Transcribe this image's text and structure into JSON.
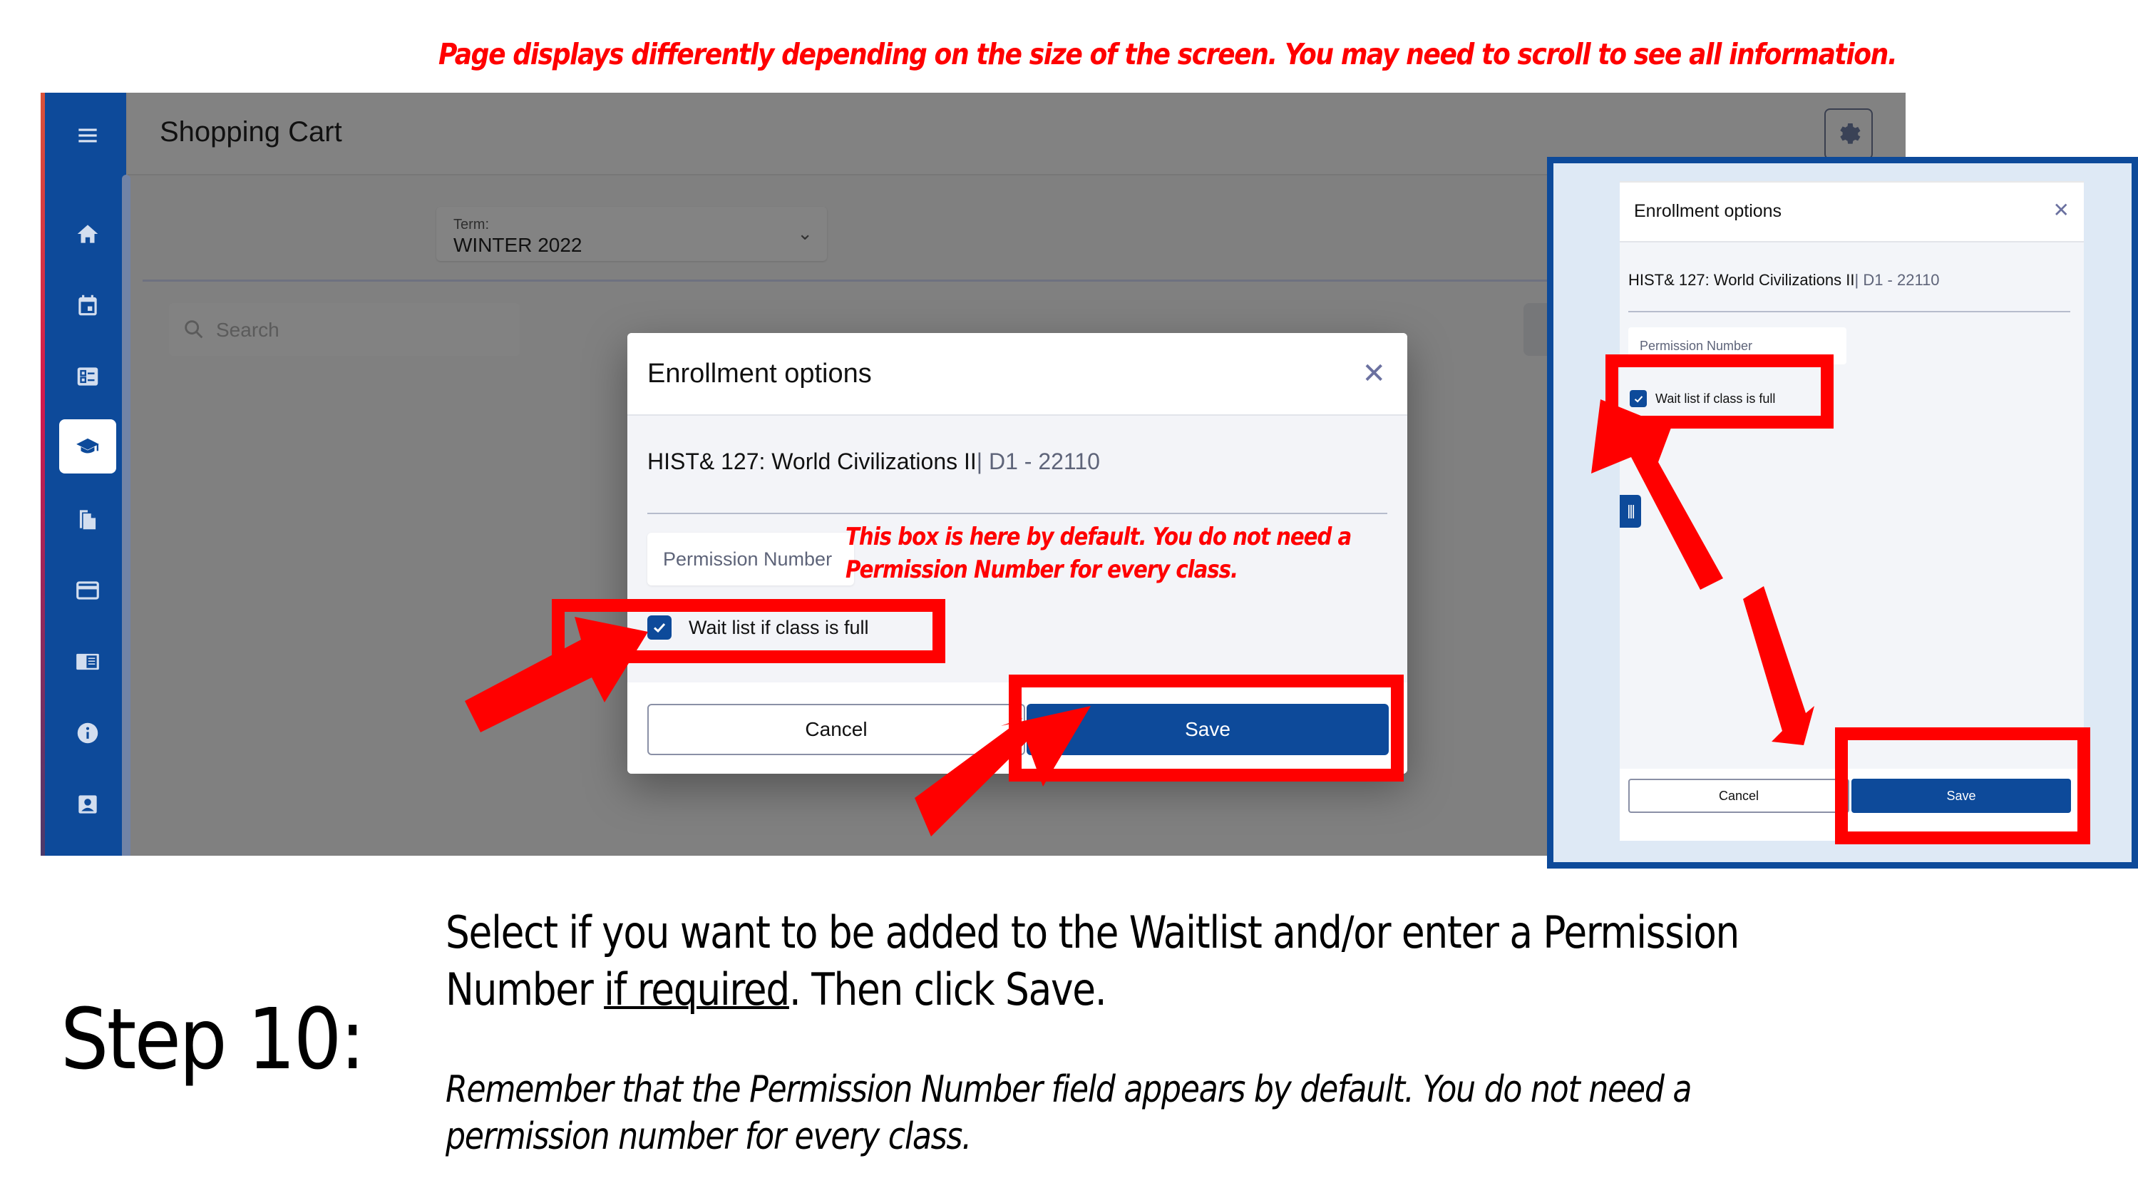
{
  "top_note": "Page displays differently depending on the size of the screen. You may need to scroll to see all information.",
  "app": {
    "header_title": "Shopping Cart",
    "settings_icon": "gear-icon",
    "term": {
      "label": "Term:",
      "value": "WINTER 2022"
    },
    "search": {
      "placeholder": "Search"
    },
    "sidebar": {
      "menu_icon": "hamburger-menu-icon",
      "items": [
        {
          "icon": "home-icon",
          "active": false
        },
        {
          "icon": "calendar-icon",
          "active": false
        },
        {
          "icon": "checklist-icon",
          "active": false
        },
        {
          "icon": "graduation-cap-icon",
          "active": true
        },
        {
          "icon": "documents-icon",
          "active": false
        },
        {
          "icon": "credit-card-icon",
          "active": false
        },
        {
          "icon": "catalog-icon",
          "active": false
        },
        {
          "icon": "info-icon",
          "active": false
        },
        {
          "icon": "profile-icon",
          "active": false
        }
      ]
    }
  },
  "modal": {
    "title": "Enrollment options",
    "close_icon": "close-icon",
    "course": "HIST& 127: World Civilizations II",
    "section_separator": "|",
    "section": " D1 - 22110",
    "permission_placeholder": "Permission Number",
    "waitlist_label": "Wait list if class is full",
    "waitlist_checked": true,
    "cancel_label": "Cancel",
    "save_label": "Save"
  },
  "annotation": {
    "line1": "This box is here by default. You do not need a",
    "line2": "Permission Number for every class."
  },
  "inset": {
    "title": "Enrollment options",
    "course": "HIST& 127: World Civilizations II",
    "section_separator": "|",
    "section": " D1 - 22110",
    "permission_placeholder": "Permission Number",
    "waitlist_label": "Wait list if class is full",
    "waitlist_checked": true,
    "handle_glyph": "|||",
    "cancel_label": "Cancel",
    "save_label": "Save"
  },
  "instructions": {
    "step_label": "Step 10:",
    "line_a1": "Select if you want to be added to the ",
    "line_a2": "Waitlist",
    "line_a3": " and/or enter a ",
    "line_a4": "Permission Number",
    "line_a5": " ",
    "line_a6": "if required",
    "line_a7": ". Then click ",
    "line_a8": "Save",
    "line_a9": ".",
    "remember": "Remember that the Permission Number field appears by default.  You do not need a permission number for every class."
  },
  "colors": {
    "brand_blue": "#0d4a9a",
    "annotation_red": "#ff0000",
    "overlay_gray": "#808080"
  }
}
